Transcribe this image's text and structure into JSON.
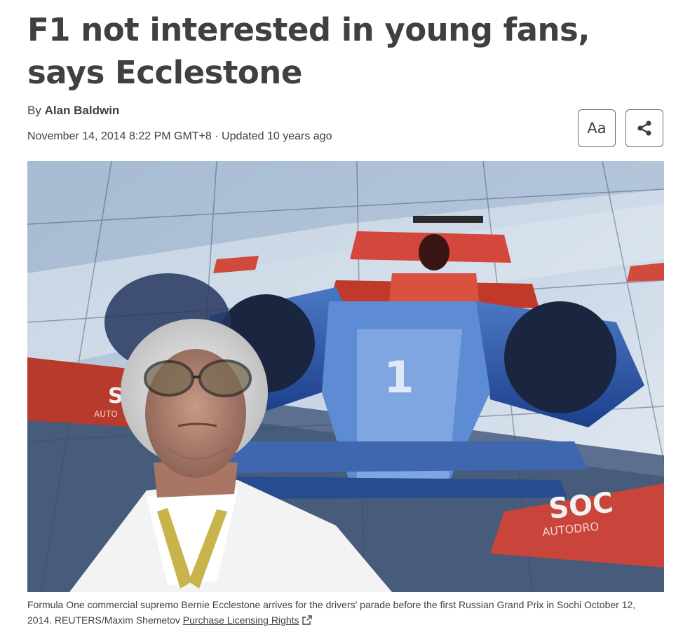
{
  "article": {
    "headline": "F1 not interested in young fans, says Ecclestone",
    "byline_prefix": "By",
    "author": "Alan Baldwin",
    "dateline": "November 14, 2014 8:22 PM GMT+8 · Updated 10 years ago"
  },
  "toolbar": {
    "font_size_label": "Aa",
    "font_icon": "font-size-icon",
    "share_icon": "share-icon"
  },
  "photo": {
    "car_number": "1",
    "banner_text_left": "SO",
    "banner_text_right": "SOC",
    "banner_sub_left": "AUTO",
    "banner_sub_right": "AUTODRO"
  },
  "caption": {
    "text": "Formula One commercial supremo Bernie Ecclestone arrives for the drivers' parade before the first Russian Grand Prix in Sochi October 12, 2014. REUTERS/Maxim Shemetov",
    "license_link": "Purchase Licensing Rights",
    "license_icon": "external-link-icon"
  }
}
